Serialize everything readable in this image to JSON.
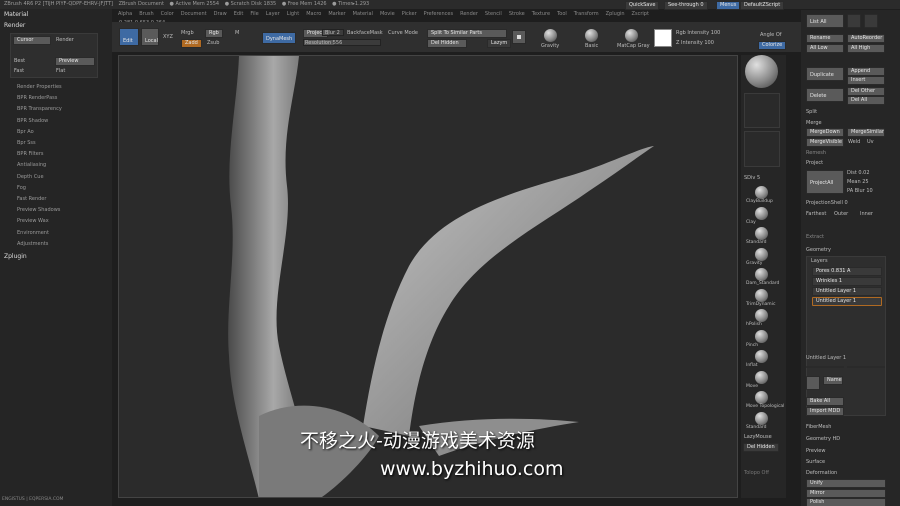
{
  "titlebar": {
    "items": [
      "ZBrush 4R6 P2 [TIJH PIYF-QDPF-EHRV-JFJTT]",
      "ZBrush Document",
      "● Active Mem 2554",
      "● Scratch Disk 1835",
      "● Free Mem 1426",
      "● Timer▸1.293"
    ],
    "quicksave": "QuickSave",
    "see_through": "See-through 0",
    "menus_btn": "Menus",
    "default_script": "DefaultZScript"
  },
  "menubar": [
    "Alpha",
    "Brush",
    "Color",
    "Document",
    "Draw",
    "Edit",
    "File",
    "Layer",
    "Light",
    "Macro",
    "Marker",
    "Material",
    "Movie",
    "Picker",
    "Preferences",
    "Render",
    "Stencil",
    "Stroke",
    "Texture",
    "Tool",
    "Transform",
    "Zplugin",
    "Zscript"
  ],
  "coords": "0.281,0.653,0.264",
  "left": {
    "material": "Material",
    "render": "Render",
    "cursor": "Cursor",
    "render_btn": "Render",
    "best": "Best",
    "preview": "Preview",
    "fast": "Fast",
    "flat": "Flat",
    "items": [
      "Render Properties",
      "BPR RenderPass",
      "BPR Transparency",
      "BPR Shadow",
      "Bpr Ao",
      "Bpr Sss",
      "BPR Filters",
      "Antialiasing",
      "Depth Cue",
      "Fog",
      "Fast Render",
      "Preview Shadows",
      "Preview Wax",
      "Environment",
      "Adjustments"
    ],
    "zplugin": "Zplugin",
    "footer": "ENGISTUS | EQPERSIA.COM"
  },
  "toolbar": {
    "edit": "Edit",
    "local": "Local",
    "xyz": "XYZ",
    "mrgb": "Mrgb",
    "rgb": "Rgb",
    "m": "M",
    "zadd": "Zadd",
    "zsub": "Zsub",
    "dynamesh": "DynaMesh",
    "project": "Project",
    "blur": "Blur 2",
    "backfacemask": "BackfaceMask",
    "resolution": "Resolution 556",
    "curve_mode": "Curve Mode",
    "split_similar": "Split To Similar Parts",
    "del_hidden": "Del Hidden",
    "lazymouse": "Lazym",
    "gravity": "Gravity",
    "basic": "Basic",
    "matcap_gray": "MatCap Gray",
    "rgb_intensity": "Rgb Intensity 100",
    "z_intensity": "Z Intensity 100",
    "angle_of": "Angle Of",
    "transp": "Transp",
    "colorize": "Colorize"
  },
  "shelf": {
    "buttons": [
      "Spix",
      "Zoom",
      "Actual",
      "AAHalf",
      "Dynamic",
      "Persp",
      "Floor",
      "Local",
      "LSym",
      "Gxyz"
    ],
    "brushes": [
      "ClayBuildup",
      "Clay",
      "Standard",
      "Gravity",
      "Dam_Standard",
      "TrimDynamic",
      "hPolish",
      "Pinch",
      "Inflat",
      "Move",
      "Move Topological",
      "Standard"
    ],
    "lazymouse": "LazyMouse",
    "del_hidden": "Del Hidden",
    "solo": "Solo",
    "sdiv": "SDiv 5",
    "collapse": "Tolopo Off"
  },
  "right": {
    "list_all": "List All",
    "rename": "Rename",
    "autoreorder": "AutoReorder",
    "all_low": "All Low",
    "all_high": "All High",
    "duplicate": "Duplicate",
    "append": "Append",
    "insert": "Insert",
    "delete": "Delete",
    "del_other": "Del Other",
    "del_all": "Del All",
    "split": "Split",
    "merge": "Merge",
    "mergedown": "MergeDown",
    "mergesimilar": "MergeSimilar",
    "mergevisible": "MergeVisible",
    "weld": "Weld",
    "uv": "Uv",
    "remesh": "Remesh",
    "project": "Project",
    "projectall": "ProjectAll",
    "dist": "Dist 0.02",
    "mean": "Mean 25",
    "pa_blur": "PA Blur 10",
    "projectionshell": "ProjectionShell 0",
    "farthest": "Farthest",
    "outer": "Outer",
    "inner": "Inner",
    "extract": "Extract",
    "geometry": "Geometry",
    "layers": "Layers",
    "layer_rows": [
      "Pores 0.831 A",
      "Wrinkles 1",
      "Untitled Layer 1",
      "Untitled Layer 1"
    ],
    "untitled_layer": "Untitled Layer 1",
    "name": "Name",
    "bake_all": "Bake All",
    "import_mdd": "Import MDD",
    "fibermesh": "FiberMesh",
    "geometry_hd": "Geometry HD",
    "preview": "Preview",
    "surface": "Surface",
    "deformation": "Deformation",
    "unify": "Unify",
    "mirror": "Mirror",
    "polish": "Polish"
  },
  "watermark": {
    "line1": "不移之火-动漫游戏美术资源",
    "line2": "www.byzhihuo.com"
  },
  "colors": {
    "accent_blue": "#3e6aa3",
    "accent_orange": "#b06a22",
    "panel": "#262626"
  }
}
